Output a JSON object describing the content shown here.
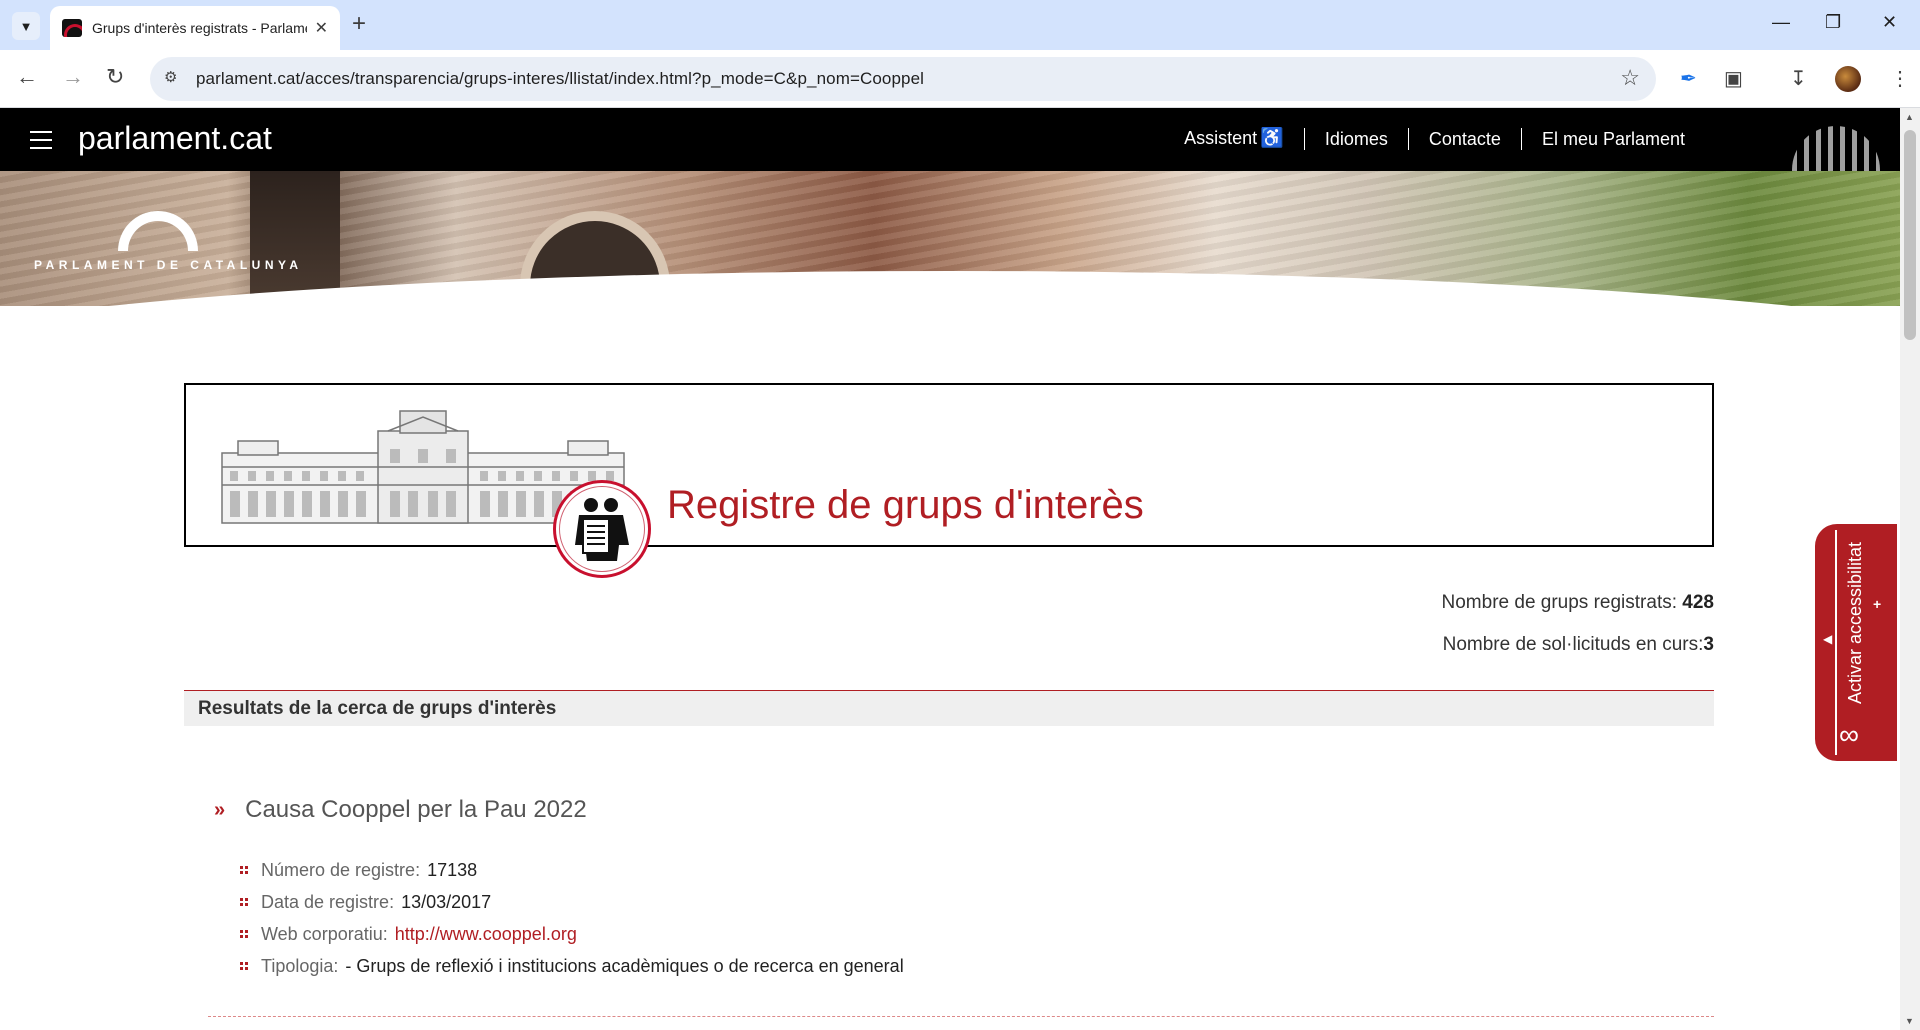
{
  "browser": {
    "tab_title": "Grups d'interès registrats - Parlament de Catalunya",
    "url": "parlament.cat/acces/transparencia/grups-interes/llistat/index.html?p_mode=C&p_nom=Cooppel"
  },
  "header": {
    "site_title": "parlament.cat",
    "nav": [
      {
        "label": "Assistent"
      },
      {
        "label": "Idiomes"
      },
      {
        "label": "Contacte"
      },
      {
        "label": "El meu Parlament"
      }
    ]
  },
  "hero": {
    "logo_text": "PARLAMENT DE CATALUNYA"
  },
  "banner": {
    "title": "Registre de grups d'interès"
  },
  "counters": {
    "groups_label": "Nombre de grups registrats:",
    "groups_value": "428",
    "requests_label": "Nombre de sol·licituds en curs:",
    "requests_value": "3"
  },
  "results": {
    "heading": "Resultats de la cerca de grups d'interès",
    "items": [
      {
        "name": "Causa Cooppel per la Pau 2022",
        "reg_label": "Número de registre:",
        "reg_value": "17138",
        "date_label": "Data de registre:",
        "date_value": "13/03/2017",
        "web_label": "Web corporatiu:",
        "web_value": "http://www.cooppel.org",
        "type_label": "Tipologia:",
        "type_value": "- Grups de reflexió i institucions acadèmiques o de recerca en general"
      }
    ]
  },
  "accessibility": {
    "label": "Activar accessibilitat"
  },
  "colors": {
    "brand_red": "#b01e23",
    "header_bg": "#000000",
    "chrome_tabbar": "#d3e3fd"
  }
}
